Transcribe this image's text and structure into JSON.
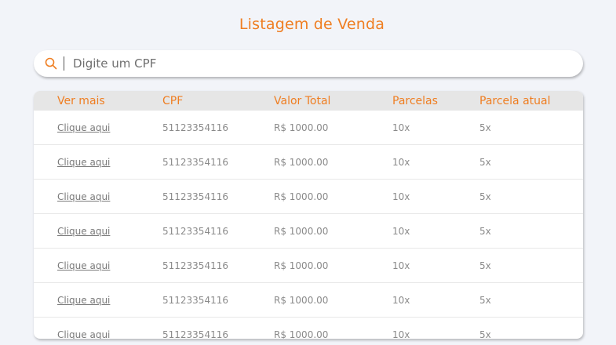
{
  "page": {
    "title": "Listagem de Venda"
  },
  "search": {
    "placeholder": "Digite um CPF",
    "value": ""
  },
  "colors": {
    "accent": "#ef7e22",
    "background": "#f2f4f9"
  },
  "table": {
    "headers": [
      "Ver mais",
      "CPF",
      "Valor Total",
      "Parcelas",
      "Parcela atual"
    ],
    "rows": [
      {
        "link": "Clique aqui",
        "cpf": "51123354116",
        "valor": "R$ 1000.00",
        "parcelas": "10x",
        "atual": "5x"
      },
      {
        "link": "Clique aqui",
        "cpf": "51123354116",
        "valor": "R$ 1000.00",
        "parcelas": "10x",
        "atual": "5x"
      },
      {
        "link": "Clique aqui",
        "cpf": "51123354116",
        "valor": "R$ 1000.00",
        "parcelas": "10x",
        "atual": "5x"
      },
      {
        "link": "Clique aqui",
        "cpf": "51123354116",
        "valor": "R$ 1000.00",
        "parcelas": "10x",
        "atual": "5x"
      },
      {
        "link": "Clique aqui",
        "cpf": "51123354116",
        "valor": "R$ 1000.00",
        "parcelas": "10x",
        "atual": "5x"
      },
      {
        "link": "Clique aqui",
        "cpf": "51123354116",
        "valor": "R$ 1000.00",
        "parcelas": "10x",
        "atual": "5x"
      },
      {
        "link": "Clique aqui",
        "cpf": "51123354116",
        "valor": "R$ 1000.00",
        "parcelas": "10x",
        "atual": "5x"
      }
    ]
  }
}
